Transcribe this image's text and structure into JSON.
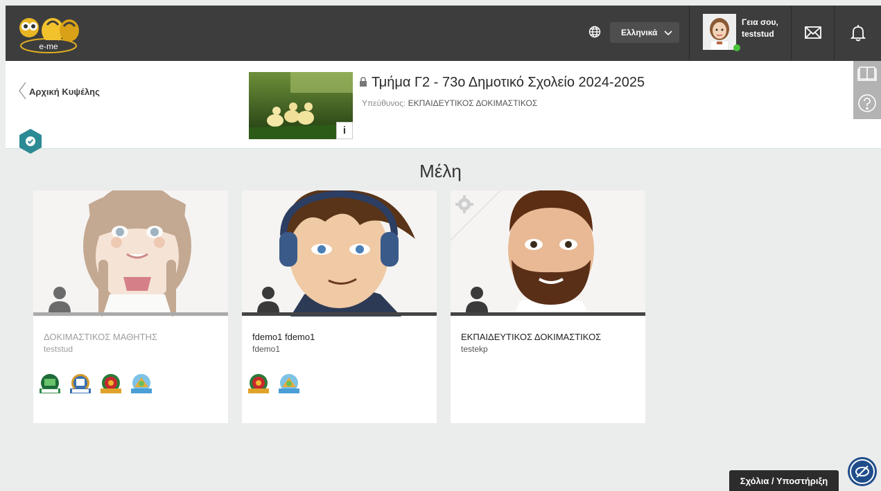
{
  "header": {
    "language": "Ελληνικά",
    "greeting_line1": "Γεια σου,",
    "greeting_line2": "teststud"
  },
  "breadcrumb": {
    "back_label": "Αρχική Κυψέλης"
  },
  "class_info": {
    "title": "Τμήμα Γ2 - 73ο Δημοτικό Σχολείο 2024-2025",
    "responsible_label": "Υπεύθυνος:",
    "responsible_name": "ΕΚΠΑΙΔΕΥΤΙΚΟΣ ΔΟΚΙΜΑΣΤΙΚΟΣ",
    "info_label": "i"
  },
  "members": {
    "title": "Μέλη",
    "cards": [
      {
        "name": "ΔΟΚΙΜΑΣΤΙΚΟΣ ΜΑΘΗΤΗΣ",
        "username": "teststud"
      },
      {
        "name": "fdemo1 fdemo1",
        "username": "fdemo1"
      },
      {
        "name": "ΕΚΠΑΙΔΕΥΤΙΚΟΣ ΔΟΚΙΜΑΣΤΙΚΟΣ",
        "username": "testekp"
      }
    ]
  },
  "footer": {
    "feedback_label": "Σχόλια / Υποστήριξη"
  },
  "colors": {
    "topbar": "#3d3d3d",
    "accent_teal": "#2c8a94",
    "online": "#49c339"
  }
}
